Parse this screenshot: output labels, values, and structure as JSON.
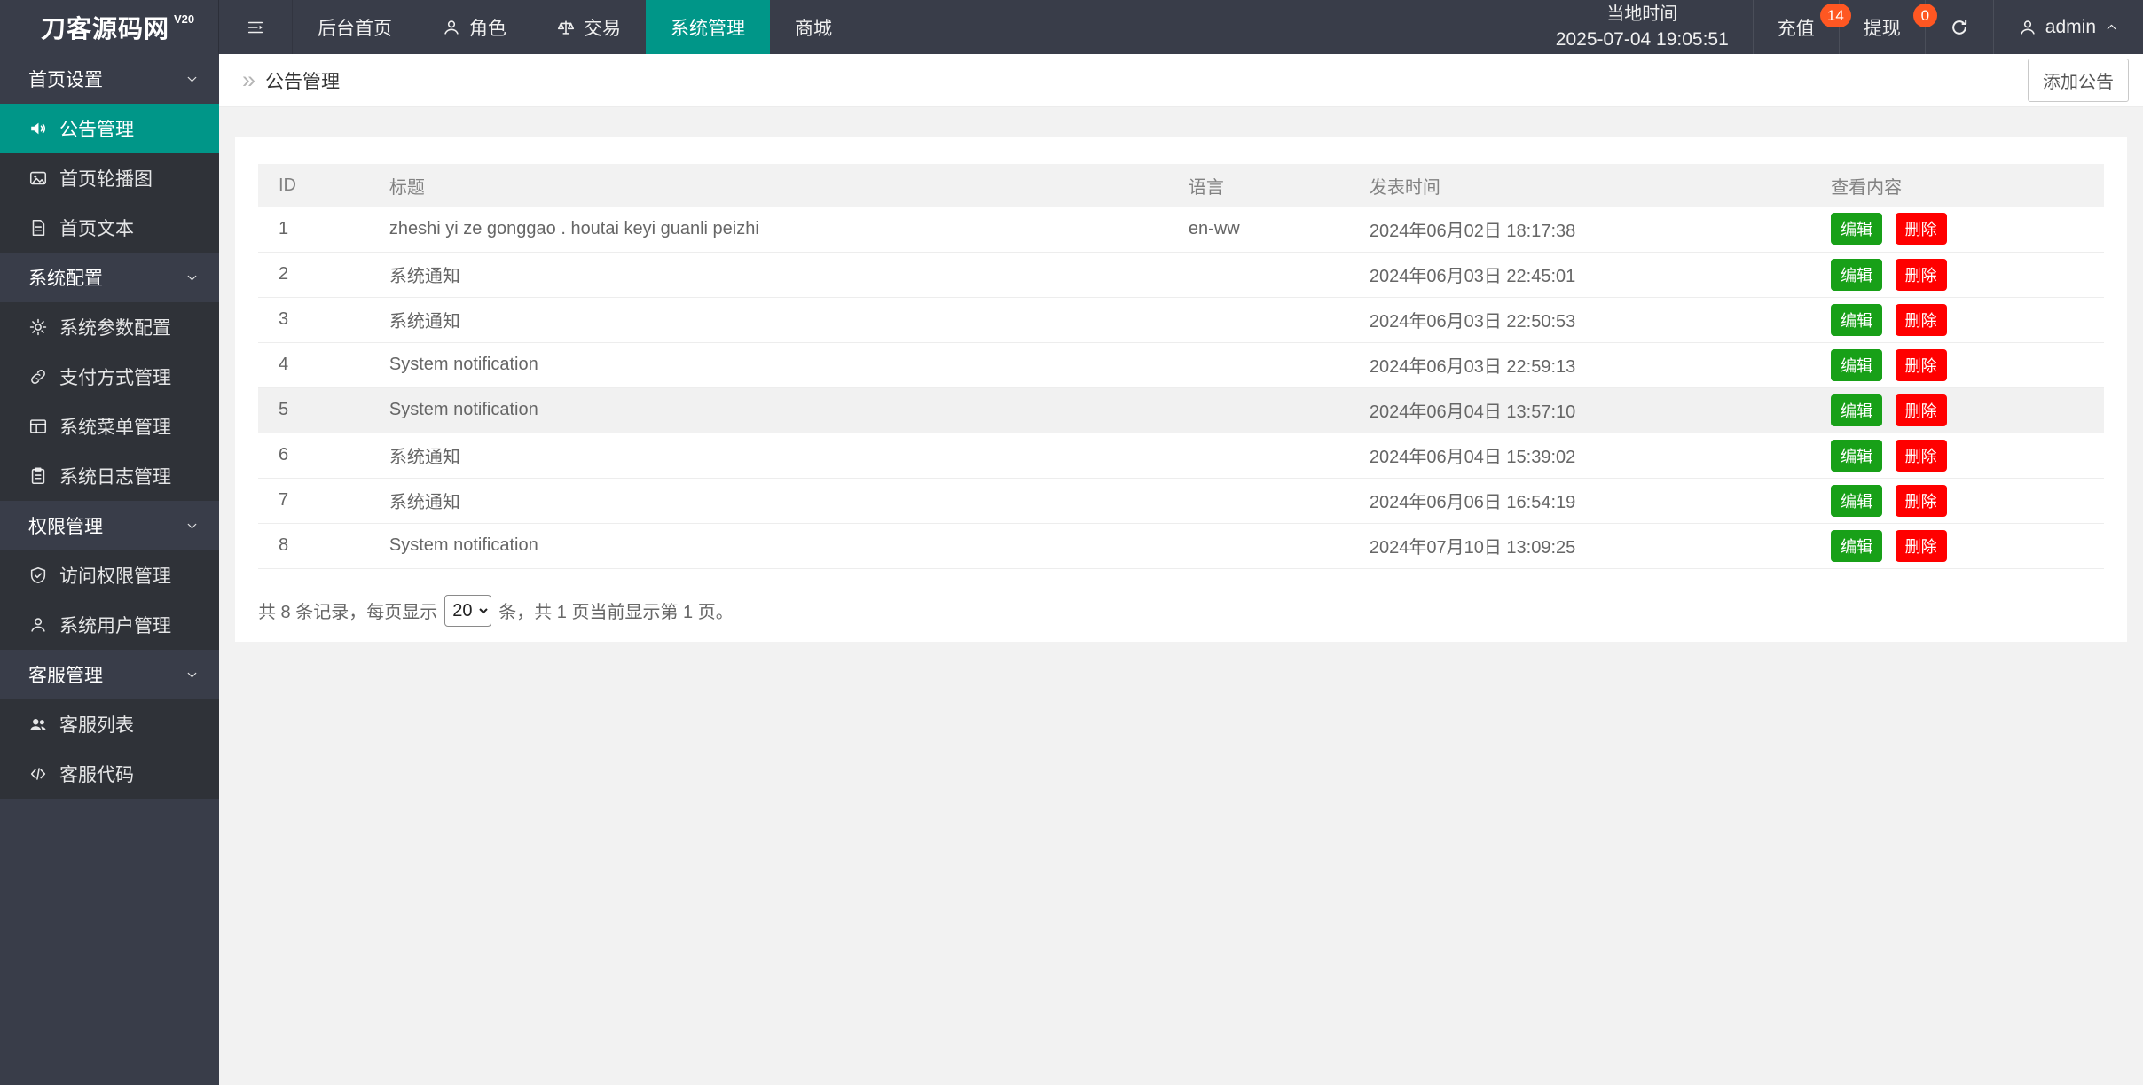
{
  "header": {
    "logo": "刀客源码网",
    "logo_version": "V20",
    "nav": [
      {
        "label": "后台首页"
      },
      {
        "label": "角色",
        "icon": "person-icon"
      },
      {
        "label": "交易",
        "icon": "scale-icon"
      },
      {
        "label": "系统管理",
        "active": true
      },
      {
        "label": "商城"
      }
    ],
    "local_time_label": "当地时间",
    "local_time_value": "2025-07-04 19:05:51",
    "recharge": {
      "label": "充值",
      "badge": "14"
    },
    "withdraw": {
      "label": "提现",
      "badge": "0"
    },
    "user": "admin"
  },
  "sidebar": {
    "sections": [
      {
        "label": "首页设置",
        "items": [
          {
            "label": "公告管理",
            "icon": "speaker-icon",
            "active": true
          },
          {
            "label": "首页轮播图",
            "icon": "image-icon"
          },
          {
            "label": "首页文本",
            "icon": "document-icon"
          }
        ]
      },
      {
        "label": "系统配置",
        "items": [
          {
            "label": "系统参数配置",
            "icon": "gear-icon"
          },
          {
            "label": "支付方式管理",
            "icon": "link-icon"
          },
          {
            "label": "系统菜单管理",
            "icon": "layout-icon"
          },
          {
            "label": "系统日志管理",
            "icon": "clipboard-icon"
          }
        ]
      },
      {
        "label": "权限管理",
        "items": [
          {
            "label": "访问权限管理",
            "icon": "shield-check-icon"
          },
          {
            "label": "系统用户管理",
            "icon": "person-icon"
          }
        ]
      },
      {
        "label": "客服管理",
        "items": [
          {
            "label": "客服列表",
            "icon": "users-icon"
          },
          {
            "label": "客服代码",
            "icon": "code-icon"
          }
        ]
      }
    ]
  },
  "main": {
    "breadcrumb": "公告管理",
    "add_button": "添加公告",
    "table": {
      "columns": [
        "ID",
        "标题",
        "语言",
        "发表时间",
        "查看内容"
      ],
      "edit_label": "编辑",
      "delete_label": "删除",
      "highlighted_row_id": "5",
      "rows": [
        {
          "id": "1",
          "title": "zheshi yi ze gonggao . houtai keyi guanli peizhi",
          "lang": "en-ww",
          "time": "2024年06月02日 18:17:38"
        },
        {
          "id": "2",
          "title": "系统通知",
          "lang": "",
          "time": "2024年06月03日 22:45:01"
        },
        {
          "id": "3",
          "title": "系统通知",
          "lang": "",
          "time": "2024年06月03日 22:50:53"
        },
        {
          "id": "4",
          "title": "System notification",
          "lang": "",
          "time": "2024年06月03日 22:59:13"
        },
        {
          "id": "5",
          "title": "System notification",
          "lang": "",
          "time": "2024年06月04日 13:57:10"
        },
        {
          "id": "6",
          "title": "系统通知",
          "lang": "",
          "time": "2024年06月04日 15:39:02"
        },
        {
          "id": "7",
          "title": "系统通知",
          "lang": "",
          "time": "2024年06月06日 16:54:19"
        },
        {
          "id": "8",
          "title": "System notification",
          "lang": "",
          "time": "2024年07月10日 13:09:25"
        }
      ]
    },
    "pagination": {
      "prefix": "共 8 条记录，每页显示",
      "page_size": "20",
      "suffix": "条，共 1 页当前显示第 1 页。"
    }
  },
  "colors": {
    "header_bg": "#393D49",
    "sidebar_group_bg": "#2F3238",
    "accent_teal": "#009688",
    "badge": "#FF5722",
    "edit_green": "#18A018",
    "delete_red": "#FF0000"
  }
}
